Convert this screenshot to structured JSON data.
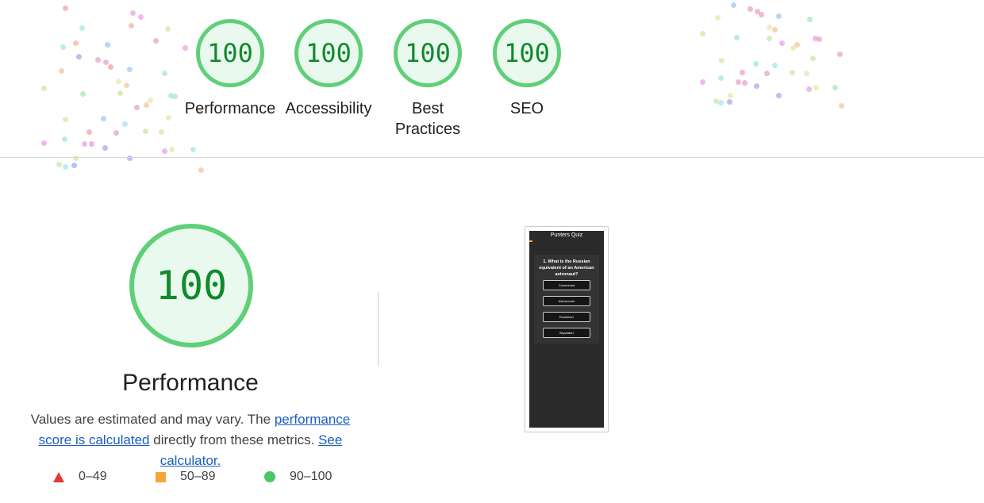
{
  "top_gauges": [
    {
      "score": "100",
      "label": "Performance"
    },
    {
      "score": "100",
      "label": "Accessibility"
    },
    {
      "score": "100",
      "label": "Best Practices"
    },
    {
      "score": "100",
      "label": "SEO"
    }
  ],
  "performance": {
    "score": "100",
    "title": "Performance",
    "description_text_1": "Values are estimated and may vary. The ",
    "score_link": "performance score is calculated",
    "description_text_2": " directly from these metrics. ",
    "calculator_link": "See calculator."
  },
  "legend": {
    "fail": "0–49",
    "average": "50–89",
    "pass": "90–100"
  },
  "screenshot": {
    "app_title": "Punters Quiz",
    "question": "1. What is the Russian equivalent of an American astronaut?",
    "options": [
      "Cosmonaut",
      "Astronomer",
      "Rocketeer",
      "Skywalker"
    ]
  },
  "colors": {
    "pass_green": "#0f8a2d",
    "pass_ring": "#5fcf78",
    "fail_red": "#e53935",
    "average_orange": "#f4a63a",
    "link_blue": "#1a5fbf"
  }
}
